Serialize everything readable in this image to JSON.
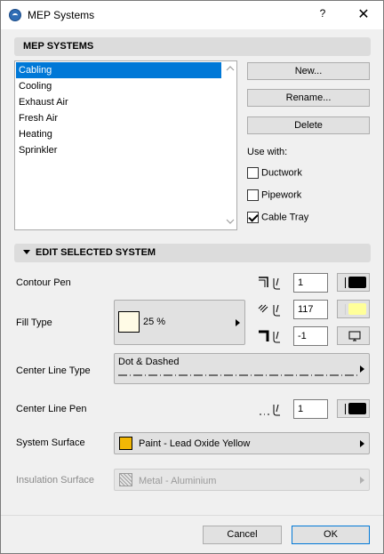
{
  "window": {
    "title": "MEP Systems",
    "help_label": "?",
    "close_label": "✕"
  },
  "systems_section": {
    "header": "MEP SYSTEMS",
    "items": [
      "Cabling",
      "Cooling",
      "Exhaust Air",
      "Fresh Air",
      "Heating",
      "Sprinkler"
    ],
    "selected_index": 0,
    "buttons": {
      "new": "New...",
      "rename": "Rename...",
      "delete": "Delete"
    },
    "use_with_label": "Use with:",
    "use_with": [
      {
        "label": "Ductwork",
        "checked": false
      },
      {
        "label": "Pipework",
        "checked": false
      },
      {
        "label": "Cable Tray",
        "checked": true
      }
    ]
  },
  "edit_section": {
    "header": "EDIT SELECTED SYSTEM",
    "contour_pen": {
      "label": "Contour Pen",
      "value": "1",
      "color": "#000000"
    },
    "fill_type": {
      "label": "Fill Type",
      "value": "25 %",
      "fg_pen": "117",
      "fg_color": "#ffff99",
      "bg_pen": "-1"
    },
    "center_line_type": {
      "label": "Center Line Type",
      "value": "Dot & Dashed"
    },
    "center_line_pen": {
      "label": "Center Line Pen",
      "value": "1",
      "color": "#000000"
    },
    "system_surface": {
      "label": "System Surface",
      "value": "Paint - Lead Oxide Yellow",
      "color": "#f2b705"
    },
    "insulation_surface": {
      "label": "Insulation Surface",
      "value": "Metal - Aluminium",
      "enabled": false
    }
  },
  "footer": {
    "cancel": "Cancel",
    "ok": "OK"
  }
}
